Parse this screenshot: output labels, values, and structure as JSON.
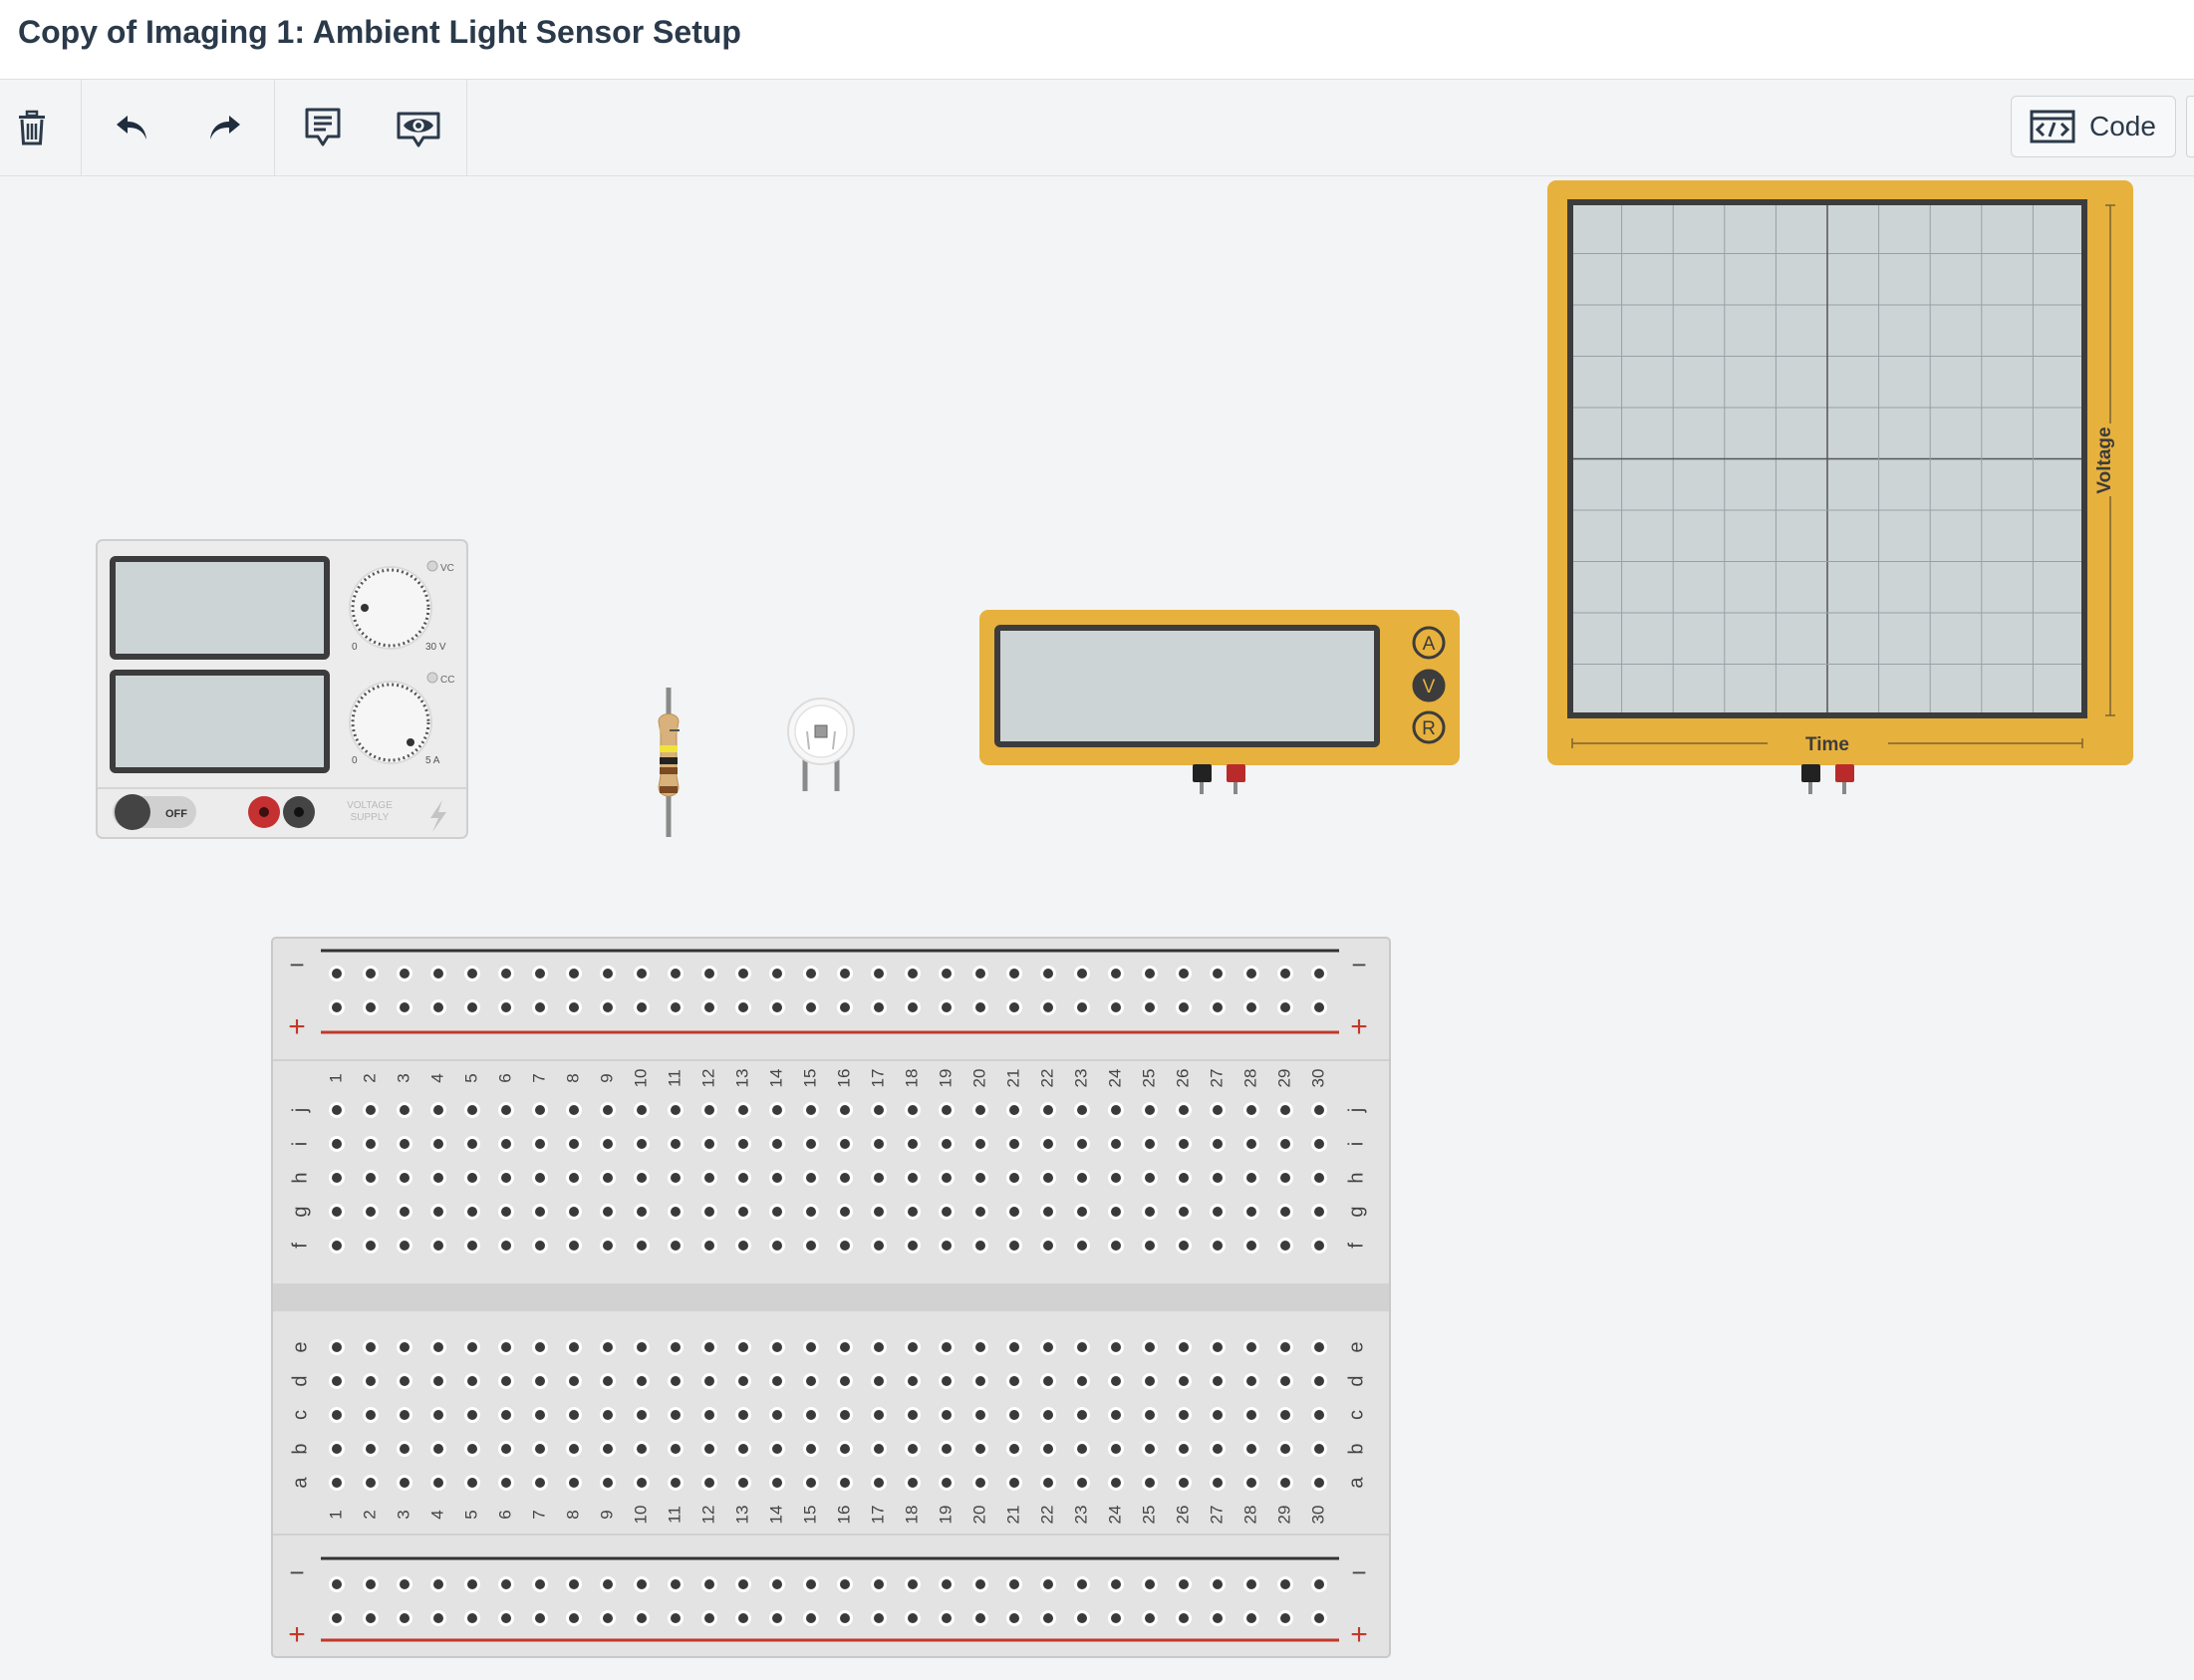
{
  "title": "Copy of Imaging 1: Ambient Light Sensor Setup",
  "toolbar": {
    "buttons": [
      {
        "name": "delete",
        "icon": "trash-icon"
      },
      {
        "name": "undo",
        "icon": "undo-icon"
      },
      {
        "name": "redo",
        "icon": "redo-icon"
      },
      {
        "name": "notes",
        "icon": "notes-icon"
      },
      {
        "name": "visibility",
        "icon": "eye-icon"
      }
    ],
    "code_label": "Code",
    "code_icon": "code-window-icon"
  },
  "power_supply": {
    "vc_label": "VC",
    "cc_label": "CC",
    "voltage_min": "0",
    "voltage_max": "30 V",
    "current_min": "0",
    "current_max": "5 A",
    "switch_label": "OFF",
    "brand_label_1": "VOLTAGE",
    "brand_label_2": "SUPPLY"
  },
  "multimeter": {
    "modes": [
      "A",
      "V",
      "R"
    ]
  },
  "oscilloscope": {
    "y_label": "Voltage",
    "x_label": "Time"
  },
  "breadboard": {
    "columns": [
      "1",
      "2",
      "3",
      "4",
      "5",
      "6",
      "7",
      "8",
      "9",
      "10",
      "11",
      "12",
      "13",
      "14",
      "15",
      "16",
      "17",
      "18",
      "19",
      "20",
      "21",
      "22",
      "23",
      "24",
      "25",
      "26",
      "27",
      "28",
      "29",
      "30"
    ],
    "top_rows": [
      "j",
      "i",
      "h",
      "g",
      "f"
    ],
    "bottom_rows": [
      "e",
      "d",
      "c",
      "b",
      "a"
    ],
    "rail_minus": "−",
    "rail_plus": "+"
  },
  "colors": {
    "instrument_yellow": "#e7b13d",
    "screen_gray": "#cdd4d6",
    "rail_red": "#c0392b",
    "rail_black": "#333333"
  }
}
